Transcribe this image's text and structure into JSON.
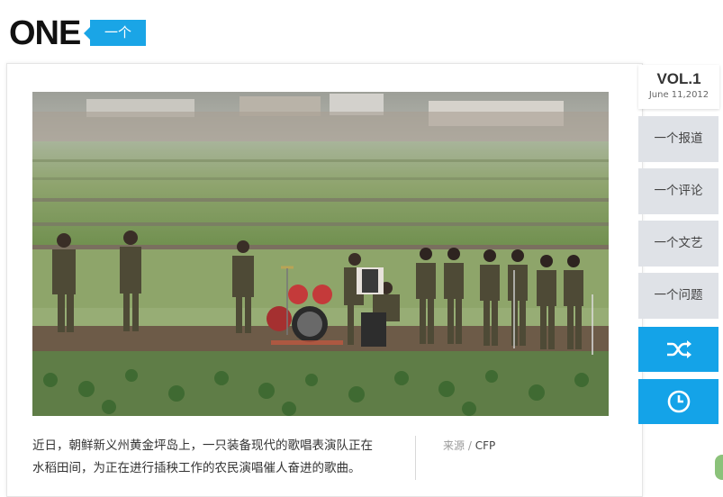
{
  "header": {
    "logo": "ONE",
    "tag": "一个"
  },
  "issue": {
    "vol": "VOL.1",
    "date": "June 11,2012"
  },
  "nav": {
    "items": [
      {
        "label": "一个报道"
      },
      {
        "label": "一个评论"
      },
      {
        "label": "一个文艺"
      },
      {
        "label": "一个问题"
      }
    ],
    "shuffle_icon": "shuffle-icon",
    "history_icon": "clock-icon"
  },
  "article": {
    "caption_line1": "近日，朝鲜新义州黄金坪岛上，一只装备现代的歌唱表演队正在",
    "caption_line2": "水稻田间，为正在进行插秧工作的农民演唱催人奋进的歌曲。",
    "source_label": "来源",
    "source_sep": "/",
    "source_value": "CFP"
  },
  "colors": {
    "accent": "#14a3e8",
    "nav_bg": "#dfe2e7"
  }
}
